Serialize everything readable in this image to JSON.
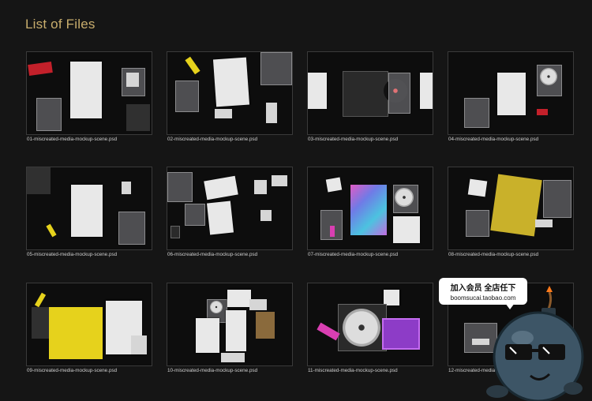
{
  "header": {
    "title": "List of Files"
  },
  "files": [
    {
      "name": "01-miscreated-media-mockup-scene.psd"
    },
    {
      "name": "02-miscreated-media-mockup-scene.psd"
    },
    {
      "name": "03-miscreated-media-mockup-scene.psd"
    },
    {
      "name": "04-miscreated-media-mockup-scene.psd"
    },
    {
      "name": "05-miscreated-media-mockup-scene.psd"
    },
    {
      "name": "06-miscreated-media-mockup-scene.psd"
    },
    {
      "name": "07-miscreated-media-mockup-scene.psd"
    },
    {
      "name": "08-miscreated-media-mockup-scene.psd"
    },
    {
      "name": "09-miscreated-media-mockup-scene.psd"
    },
    {
      "name": "10-miscreated-media-mockup-scene.psd"
    },
    {
      "name": "11-miscreated-media-mockup-scene.psd"
    },
    {
      "name": "12-miscreated-media-mockup-scene.psd"
    }
  ],
  "promo": {
    "line1": "加入会员 全店任下",
    "line2": "boomsucai.taobao.com"
  },
  "colors": {
    "title": "#c8ad6d",
    "background": "#151515",
    "caption": "#cfcfcf"
  }
}
